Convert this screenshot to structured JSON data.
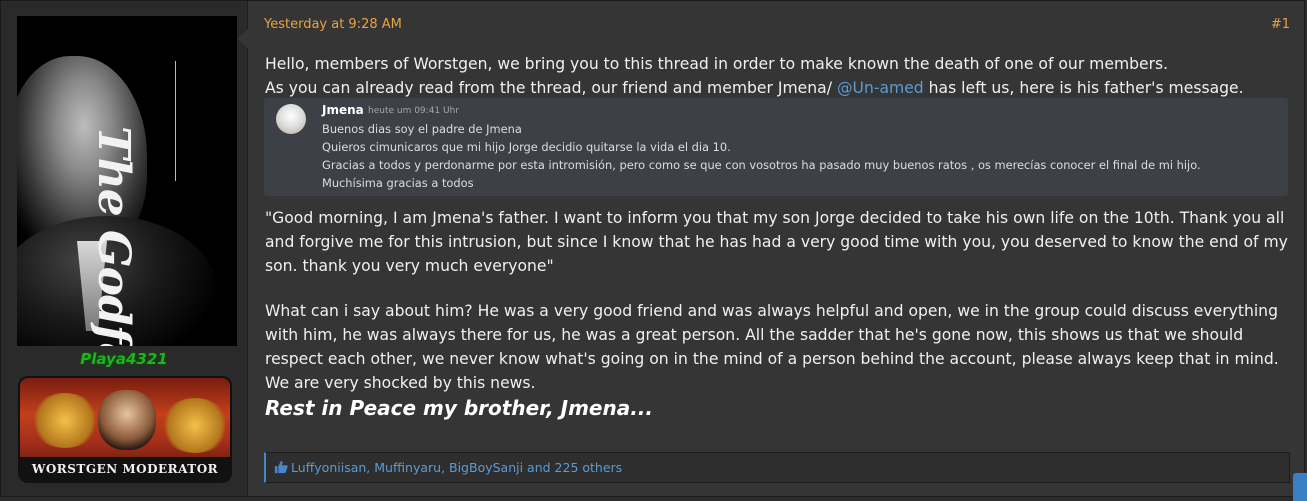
{
  "user": {
    "username": "Playa4321",
    "avatar_title": "The Godfather",
    "banner_label": "WORSTGEN MODERATOR"
  },
  "post": {
    "timestamp": "Yesterday at 9:28 AM",
    "post_number": "#1",
    "line1": "Hello, members of Worstgen, we bring you to this thread in order to make known the death of one of our members.",
    "line2_before": "As you can already read from the thread, our friend and member Jmena/ ",
    "mention": "@Un-amed",
    "line2_after": " has left us, here is his father's message.",
    "quote": {
      "author": "Jmena",
      "time": "heute um 09:41 Uhr",
      "lines": [
        "Buenos dias soy el padre de Jmena",
        "Quieros cimunicaros que mi hijo Jorge decidio quitarse la vida el dia 10.",
        "Gracias a todos y perdonarme por esta intromisión, pero como se que con vosotros ha pasado muy buenos ratos , os merecías conocer el final de mi hijo.",
        "Muchísima gracias  a todos"
      ]
    },
    "translation": "\"Good morning, I am Jmena's father. I want to inform you that my son Jorge decided to take his own life on the 10th. Thank you all and forgive me for this intrusion, but since I know that he has had a very good time with you, you deserved to know the end of my son. thank you very much everyone\"",
    "reflection": "What can i say about him? He was a very good friend and was always helpful and open, we in the group could discuss everything with him, he was always there for us, he was a great person. All the sadder that he's gone now, this shows us that we should respect each other, we never know what's going on in the mind of a person behind the account, please always keep that in mind. We are very shocked by this news.",
    "closing": "Rest in Peace my brother, Jmena...",
    "reactions": "Luffyoniisan, Muffinyaru, BigBoySanji and 225 others"
  },
  "icons": {
    "like": "thumbs-up-icon",
    "scroll": "scroll-to-top-icon"
  },
  "colors": {
    "accent_orange": "#e8a33d",
    "link_blue": "#5b9bd5",
    "username_green": "#1fb31f"
  }
}
